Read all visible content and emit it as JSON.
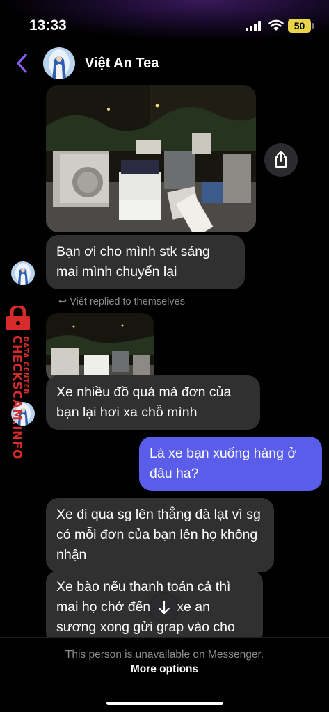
{
  "status_bar": {
    "time": "13:33",
    "battery": "50"
  },
  "header": {
    "contact_name": "Việt An Tea",
    "avatar_icon": "virgin-mary-avatar-icon"
  },
  "messages": [
    {
      "type": "image",
      "from": "contact",
      "description_icon": "photo-of-furniture-pile-at-night"
    },
    {
      "type": "text",
      "from": "contact",
      "text": "Bạn ơi cho mình stk sáng mai mình chuyển lại"
    },
    {
      "type": "reply_note",
      "text": "Việt replied to themselves"
    },
    {
      "type": "image",
      "from": "contact",
      "description_icon": "photo-of-furniture-pile-at-night"
    },
    {
      "type": "text",
      "from": "contact",
      "text": "Xe nhiều đồ quá mà đơn của bạn lại hơi xa chỗ mình"
    },
    {
      "type": "text",
      "from": "me",
      "text": "Là xe bạn xuống hàng ở đâu ha?"
    },
    {
      "type": "text",
      "from": "contact",
      "text": "Xe đi qua sg lên thẳng đà lạt vì sg có mỗi đơn của bạn lên họ không nhận"
    },
    {
      "type": "text",
      "from": "contact",
      "text": "Xe bào nếu thanh toán cả thì mai họ chở đến tận xe an sương xong gửi grap vào cho"
    }
  ],
  "watermark": {
    "main": "CHECKSCAM.INFO",
    "sub": "DATA CENTER"
  },
  "footer": {
    "unavailable": "This person is unavailable on Messenger.",
    "more_options": "More options"
  },
  "colors": {
    "accent": "#5a5dea",
    "incoming_bubble": "#303030",
    "watermark": "#d52b2b",
    "battery": "#e8d54a"
  }
}
